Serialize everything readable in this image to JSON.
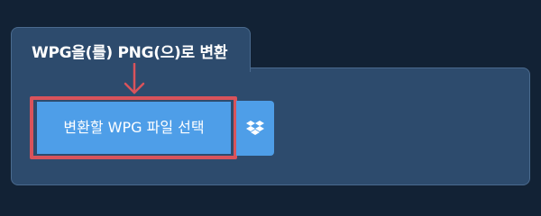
{
  "converter": {
    "tab_title": "WPG을(를) PNG(으)로 변환",
    "select_button_label": "변환할 WPG 파일 선택"
  },
  "icons": {
    "arrow": "down-arrow-icon",
    "dropbox": "dropbox-icon"
  },
  "colors": {
    "page_background": "#122235",
    "panel_background": "#2d4b6d",
    "panel_border": "#4a6a8e",
    "button": "#4e9ee8",
    "highlight": "#d9535b",
    "text": "#ffffff"
  }
}
